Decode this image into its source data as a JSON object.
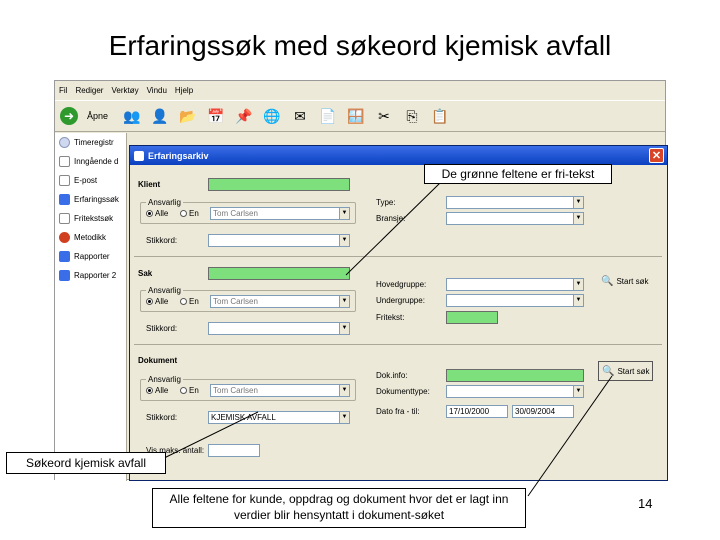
{
  "slide": {
    "title": "Erfaringssøk med søkeord kjemisk avfall",
    "page_number": "14"
  },
  "menubar": [
    "Fil",
    "Rediger",
    "Verktøy",
    "Vindu",
    "Hjelp"
  ],
  "toolbar": {
    "open_label": "Åpne",
    "icons": [
      "open-icon",
      "users-icon",
      "user-check-icon",
      "folder-icon",
      "calendar-icon",
      "stamp-icon",
      "globe-mail-icon",
      "envelope-icon",
      "document-icon",
      "windows-icon",
      "scissors-icon",
      "copy-icon",
      "paste-icon"
    ]
  },
  "sidebar": {
    "items": [
      {
        "label": "Timeregistr",
        "color": "#d0d8f0"
      },
      {
        "label": "Inngående d",
        "color": "#c8c8c8"
      },
      {
        "label": "E-post",
        "color": "#e0e0e0"
      },
      {
        "label": "Erfaringssøk",
        "color": "#3a6ee8"
      },
      {
        "label": "Fritekstsøk",
        "color": "#c8c8c8"
      },
      {
        "label": "Metodikk",
        "color": "#d04020"
      },
      {
        "label": "Rapporter",
        "color": "#3a6ee8"
      },
      {
        "label": "Rapporter 2",
        "color": "#3a6ee8"
      }
    ]
  },
  "window": {
    "title": "Erfaringsarkiv",
    "close_glyph": "✕"
  },
  "klient": {
    "heading": "Klient",
    "ansvarlig_legend": "Ansvarlig",
    "radio_alle": "Alle",
    "radio_en": "En",
    "ansvarlig_value": "Tom Carlsen",
    "stikkord_label": "Stikkord:",
    "stikkord_value": "",
    "type_label": "Type:",
    "bransje_label": "Bransje:"
  },
  "sak": {
    "heading": "Sak",
    "ansvarlig_legend": "Ansvarlig",
    "radio_alle": "Alle",
    "radio_en": "En",
    "ansvarlig_value": "Tom Carlsen",
    "stikkord_label": "Stikkord:",
    "hovedgruppe_label": "Hovedgruppe:",
    "undergruppe_label": "Undergruppe:",
    "fritekst_label": "Fritekst:",
    "search_label": "Start søk"
  },
  "dokument": {
    "heading": "Dokument",
    "ansvarlig_legend": "Ansvarlig",
    "radio_alle": "Alle",
    "radio_en": "En",
    "ansvarlig_value": "Tom Carlsen",
    "stikkord_label": "Stikkord:",
    "stikkord_value": "KJEMISK AVFALL",
    "dokinfo_label": "Dok.info:",
    "dokumenttype_label": "Dokumenttype:",
    "dato_label": "Dato fra - til:",
    "dato_fra": "17/10/2000",
    "dato_til": "30/09/2004",
    "search_label": "Start søk",
    "vis_maks_label": "Vis maks. antall:"
  },
  "callouts": {
    "green_fields": "De grønne feltene er fri-tekst",
    "keyword": "Søkeord kjemisk avfall",
    "all_fields": "Alle feltene for kunde, oppdrag og dokument hvor det er lagt inn verdier blir hensyntatt i dokument-søket"
  },
  "colors": {
    "freetext_green": "#7de07d",
    "titlebar_blue": "#0a3fbf"
  }
}
